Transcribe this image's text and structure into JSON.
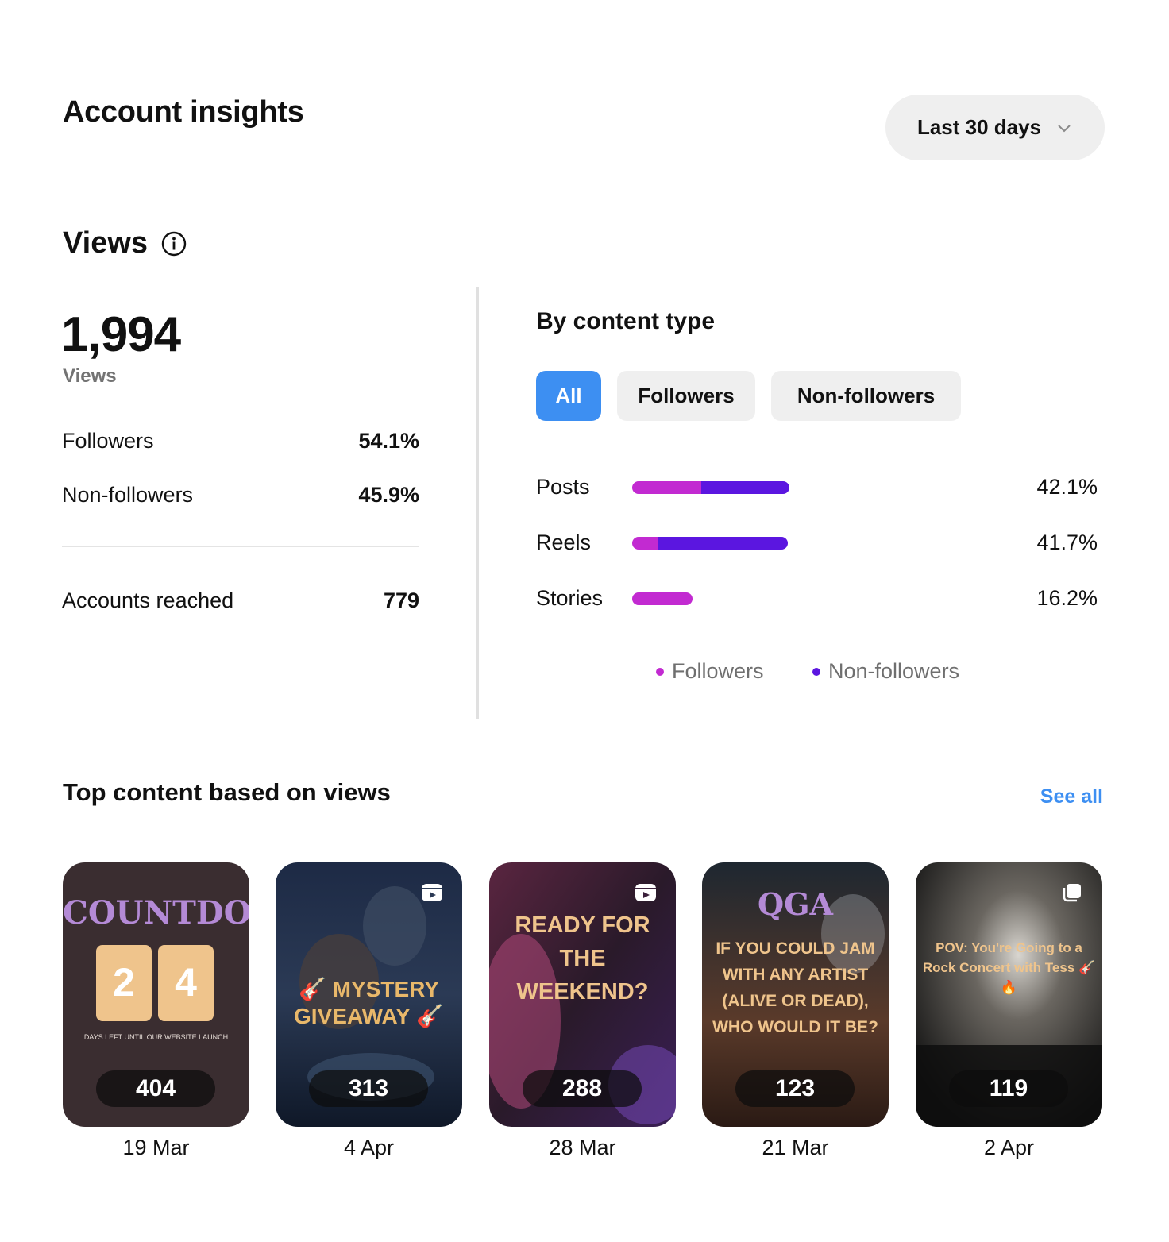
{
  "header": {
    "title": "Account insights",
    "range_label": "Last 30 days",
    "range_icon": "chevron-down-icon"
  },
  "views": {
    "title": "Views",
    "info_icon": "info-icon",
    "total": "1,994",
    "total_label": "Views",
    "rows": [
      {
        "label": "Followers",
        "value": "54.1%"
      },
      {
        "label": "Non-followers",
        "value": "45.9%"
      }
    ],
    "reached": {
      "label": "Accounts reached",
      "value": "779"
    }
  },
  "by_content": {
    "title": "By content type",
    "filters": [
      {
        "label": "All",
        "active": true
      },
      {
        "label": "Followers",
        "active": false
      },
      {
        "label": "Non-followers",
        "active": false
      }
    ],
    "legend": [
      {
        "label": "Followers",
        "color": "#c22ad1"
      },
      {
        "label": "Non-followers",
        "color": "#5b16e0"
      }
    ]
  },
  "chart_data": {
    "type": "bar",
    "orientation": "horizontal",
    "stacked": true,
    "categories": [
      "Posts",
      "Reels",
      "Stories"
    ],
    "values": [
      42.1,
      41.7,
      16.2
    ],
    "value_labels": [
      "42.1%",
      "41.7%",
      "16.2%"
    ],
    "series": [
      {
        "name": "Followers",
        "values": [
          18.6,
          7.1,
          16.2
        ]
      },
      {
        "name": "Non-followers",
        "values": [
          23.5,
          34.6,
          0
        ]
      }
    ],
    "legend_position": "bottom",
    "colors": {
      "Followers": "#c22ad1",
      "Non-followers": "#5b16e0"
    }
  },
  "top_content": {
    "title": "Top content based on views",
    "see_all": "See all",
    "items": [
      {
        "views": "404",
        "date": "19 Mar",
        "overlay_text": "COUNTDOWN",
        "digits": [
          "2",
          "4"
        ],
        "caption": "DAYS LEFT UNTIL OUR WEBSITE LAUNCH",
        "icon": ""
      },
      {
        "views": "313",
        "date": "4 Apr",
        "overlay_text": "🎸 MYSTERY GIVEAWAY 🎸",
        "icon": "reel-icon"
      },
      {
        "views": "288",
        "date": "28 Mar",
        "overlay_text": "READY FOR THE WEEKEND?",
        "icon": "reel-icon"
      },
      {
        "views": "123",
        "date": "21 Mar",
        "overlay_text": "QGA",
        "caption": "IF YOU COULD JAM WITH ANY ARTIST (ALIVE OR DEAD), WHO WOULD IT BE?",
        "icon": ""
      },
      {
        "views": "119",
        "date": "2 Apr",
        "overlay_text": "POV: You're Going to a Rock Concert with Tess 🎸🔥",
        "icon": "carousel-icon"
      }
    ]
  }
}
